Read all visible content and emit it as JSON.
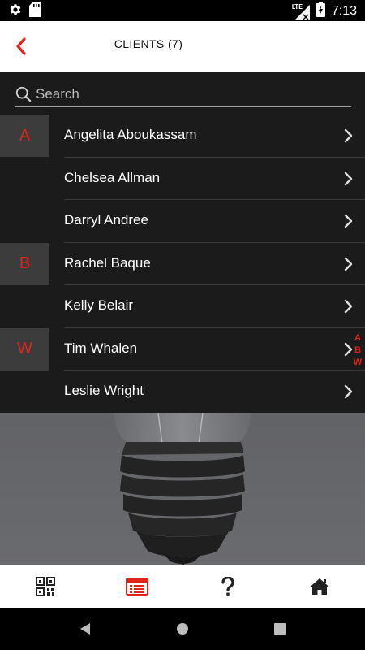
{
  "status_bar": {
    "time": "7:13",
    "network": "LTE",
    "left_icons": [
      "settings-icon",
      "sd-card-icon"
    ],
    "right_icons": [
      "lte-signal-icon",
      "battery-charging-icon"
    ]
  },
  "header": {
    "title": "CLIENTS (7)",
    "back_icon": "chevron-left-icon",
    "accent_color": "#e2231a"
  },
  "search": {
    "placeholder": "Search",
    "value": ""
  },
  "clients": [
    {
      "letter": "A",
      "name": "Angelita Aboukassam"
    },
    {
      "letter": "",
      "name": "Chelsea Allman"
    },
    {
      "letter": "",
      "name": "Darryl Andree"
    },
    {
      "letter": "B",
      "name": "Rachel Baque"
    },
    {
      "letter": "",
      "name": "Kelly Belair"
    },
    {
      "letter": "W",
      "name": "Tim Whalen"
    },
    {
      "letter": "",
      "name": "Leslie Wright"
    }
  ],
  "alpha_index": [
    "A",
    "B",
    "W"
  ],
  "tabs": [
    {
      "icon": "qr-code-icon",
      "active": false
    },
    {
      "icon": "client-list-icon",
      "active": true
    },
    {
      "icon": "help-icon",
      "active": false
    },
    {
      "icon": "home-icon",
      "active": false
    }
  ],
  "colors": {
    "accent": "#e2231a",
    "list_bg": "#1b1b1b",
    "letter_box_bg": "#3c3c3c",
    "header_bg": "#ffffff"
  }
}
